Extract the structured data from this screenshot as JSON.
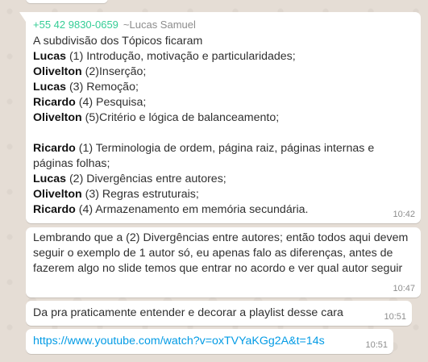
{
  "messages": [
    {
      "sender_phone": "+55 42 9830-0659",
      "sender_name": "~Lucas Samuel",
      "lines": [
        {
          "bold": "",
          "text": "A subdivisão dos Tópicos ficaram"
        },
        {
          "bold": "Lucas",
          "text": " (1) Introdução, motivação e particularidades;"
        },
        {
          "bold": "Olivelton",
          "text": " (2)Inserção;"
        },
        {
          "bold": "Lucas",
          "text": " (3) Remoção;"
        },
        {
          "bold": "Ricardo",
          "text": " (4) Pesquisa;"
        },
        {
          "bold": "Olivelton",
          "text": " (5)Critério e lógica de balanceamento;"
        },
        {
          "bold": "",
          "text": ""
        },
        {
          "bold": "Ricardo",
          "text": " (1) Terminologia de ordem, página raiz, páginas internas e"
        },
        {
          "bold": "",
          "text": "páginas folhas;"
        },
        {
          "bold": "Lucas",
          "text": " (2) Divergências entre autores;"
        },
        {
          "bold": "Olivelton",
          "text": " (3) Regras estruturais;"
        },
        {
          "bold": "Ricardo",
          "text": " (4) Armazenamento em memória secundária."
        }
      ],
      "time": "10:42"
    },
    {
      "text": "Lembrando que a (2) Divergências entre autores; então todos aqui devem seguir o exemplo de 1 autor só, eu apenas falo as diferenças, antes de fazerem algo no slide temos que entrar no acordo e ver qual autor seguir",
      "time": "10:47"
    },
    {
      "text": "Da pra praticamente entender e decorar a playlist desse cara",
      "time": "10:51"
    },
    {
      "link": "https://www.youtube.com/watch?v=oxTVYaKGg2A&t=14s",
      "time": "10:51"
    }
  ]
}
